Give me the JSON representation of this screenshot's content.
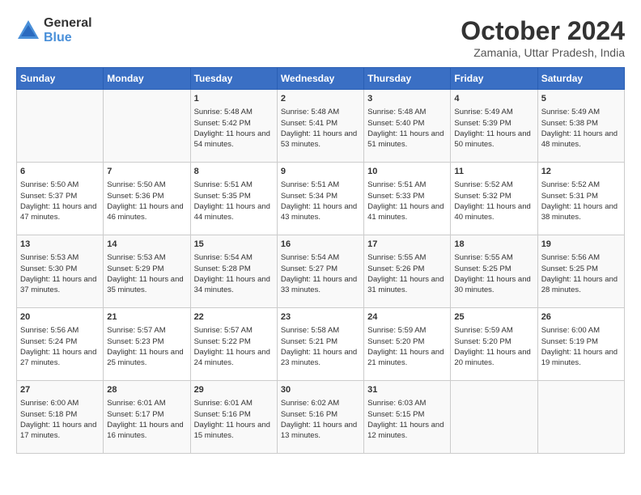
{
  "header": {
    "logo": {
      "general": "General",
      "blue": "Blue"
    },
    "title": "October 2024",
    "subtitle": "Zamania, Uttar Pradesh, India"
  },
  "days_of_week": [
    "Sunday",
    "Monday",
    "Tuesday",
    "Wednesday",
    "Thursday",
    "Friday",
    "Saturday"
  ],
  "weeks": [
    [
      {
        "day": "",
        "content": ""
      },
      {
        "day": "",
        "content": ""
      },
      {
        "day": "1",
        "content": "Sunrise: 5:48 AM\nSunset: 5:42 PM\nDaylight: 11 hours and 54 minutes."
      },
      {
        "day": "2",
        "content": "Sunrise: 5:48 AM\nSunset: 5:41 PM\nDaylight: 11 hours and 53 minutes."
      },
      {
        "day": "3",
        "content": "Sunrise: 5:48 AM\nSunset: 5:40 PM\nDaylight: 11 hours and 51 minutes."
      },
      {
        "day": "4",
        "content": "Sunrise: 5:49 AM\nSunset: 5:39 PM\nDaylight: 11 hours and 50 minutes."
      },
      {
        "day": "5",
        "content": "Sunrise: 5:49 AM\nSunset: 5:38 PM\nDaylight: 11 hours and 48 minutes."
      }
    ],
    [
      {
        "day": "6",
        "content": "Sunrise: 5:50 AM\nSunset: 5:37 PM\nDaylight: 11 hours and 47 minutes."
      },
      {
        "day": "7",
        "content": "Sunrise: 5:50 AM\nSunset: 5:36 PM\nDaylight: 11 hours and 46 minutes."
      },
      {
        "day": "8",
        "content": "Sunrise: 5:51 AM\nSunset: 5:35 PM\nDaylight: 11 hours and 44 minutes."
      },
      {
        "day": "9",
        "content": "Sunrise: 5:51 AM\nSunset: 5:34 PM\nDaylight: 11 hours and 43 minutes."
      },
      {
        "day": "10",
        "content": "Sunrise: 5:51 AM\nSunset: 5:33 PM\nDaylight: 11 hours and 41 minutes."
      },
      {
        "day": "11",
        "content": "Sunrise: 5:52 AM\nSunset: 5:32 PM\nDaylight: 11 hours and 40 minutes."
      },
      {
        "day": "12",
        "content": "Sunrise: 5:52 AM\nSunset: 5:31 PM\nDaylight: 11 hours and 38 minutes."
      }
    ],
    [
      {
        "day": "13",
        "content": "Sunrise: 5:53 AM\nSunset: 5:30 PM\nDaylight: 11 hours and 37 minutes."
      },
      {
        "day": "14",
        "content": "Sunrise: 5:53 AM\nSunset: 5:29 PM\nDaylight: 11 hours and 35 minutes."
      },
      {
        "day": "15",
        "content": "Sunrise: 5:54 AM\nSunset: 5:28 PM\nDaylight: 11 hours and 34 minutes."
      },
      {
        "day": "16",
        "content": "Sunrise: 5:54 AM\nSunset: 5:27 PM\nDaylight: 11 hours and 33 minutes."
      },
      {
        "day": "17",
        "content": "Sunrise: 5:55 AM\nSunset: 5:26 PM\nDaylight: 11 hours and 31 minutes."
      },
      {
        "day": "18",
        "content": "Sunrise: 5:55 AM\nSunset: 5:25 PM\nDaylight: 11 hours and 30 minutes."
      },
      {
        "day": "19",
        "content": "Sunrise: 5:56 AM\nSunset: 5:25 PM\nDaylight: 11 hours and 28 minutes."
      }
    ],
    [
      {
        "day": "20",
        "content": "Sunrise: 5:56 AM\nSunset: 5:24 PM\nDaylight: 11 hours and 27 minutes."
      },
      {
        "day": "21",
        "content": "Sunrise: 5:57 AM\nSunset: 5:23 PM\nDaylight: 11 hours and 25 minutes."
      },
      {
        "day": "22",
        "content": "Sunrise: 5:57 AM\nSunset: 5:22 PM\nDaylight: 11 hours and 24 minutes."
      },
      {
        "day": "23",
        "content": "Sunrise: 5:58 AM\nSunset: 5:21 PM\nDaylight: 11 hours and 23 minutes."
      },
      {
        "day": "24",
        "content": "Sunrise: 5:59 AM\nSunset: 5:20 PM\nDaylight: 11 hours and 21 minutes."
      },
      {
        "day": "25",
        "content": "Sunrise: 5:59 AM\nSunset: 5:20 PM\nDaylight: 11 hours and 20 minutes."
      },
      {
        "day": "26",
        "content": "Sunrise: 6:00 AM\nSunset: 5:19 PM\nDaylight: 11 hours and 19 minutes."
      }
    ],
    [
      {
        "day": "27",
        "content": "Sunrise: 6:00 AM\nSunset: 5:18 PM\nDaylight: 11 hours and 17 minutes."
      },
      {
        "day": "28",
        "content": "Sunrise: 6:01 AM\nSunset: 5:17 PM\nDaylight: 11 hours and 16 minutes."
      },
      {
        "day": "29",
        "content": "Sunrise: 6:01 AM\nSunset: 5:16 PM\nDaylight: 11 hours and 15 minutes."
      },
      {
        "day": "30",
        "content": "Sunrise: 6:02 AM\nSunset: 5:16 PM\nDaylight: 11 hours and 13 minutes."
      },
      {
        "day": "31",
        "content": "Sunrise: 6:03 AM\nSunset: 5:15 PM\nDaylight: 11 hours and 12 minutes."
      },
      {
        "day": "",
        "content": ""
      },
      {
        "day": "",
        "content": ""
      }
    ]
  ]
}
